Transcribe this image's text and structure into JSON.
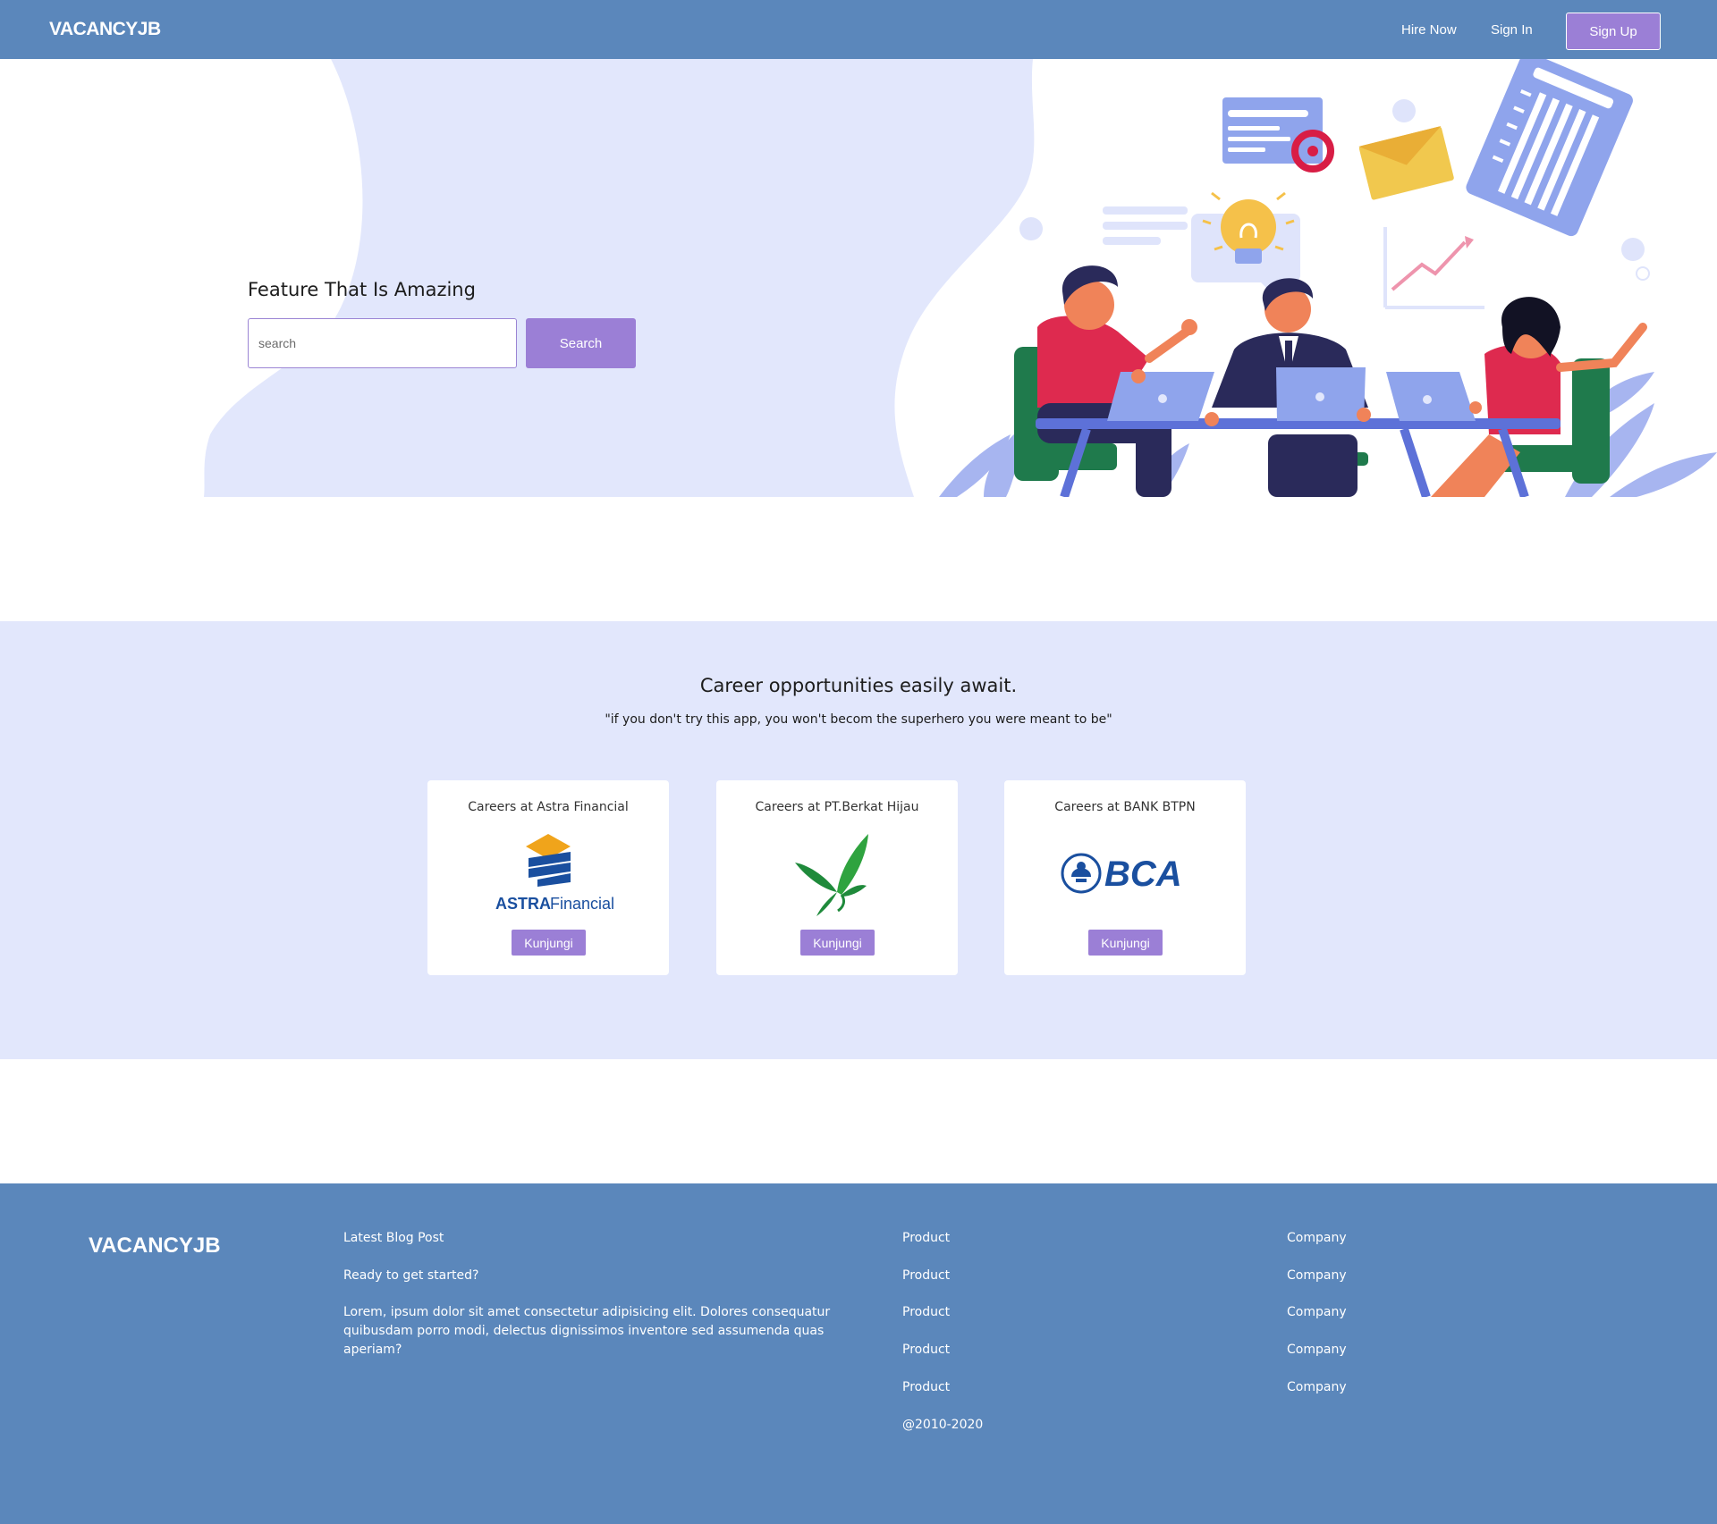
{
  "navbar": {
    "brand": "VACANCYJB",
    "hire_now": "Hire Now",
    "sign_in": "Sign In",
    "sign_up": "Sign Up"
  },
  "hero": {
    "title": "Feature That Is Amazing",
    "search_placeholder": "search",
    "search_button": "Search"
  },
  "careers": {
    "title": "Career opportunities easily await.",
    "subtitle": "\"if you don't try this app, you won't becom the superhero you were meant to be\"",
    "cards": [
      {
        "title": "Careers at Astra Financial",
        "logo_text": "ASTRA",
        "logo_text_2": "Financial",
        "button": "Kunjungi"
      },
      {
        "title": "Careers at PT.Berkat Hijau",
        "button": "Kunjungi"
      },
      {
        "title": "Careers at BANK BTPN",
        "logo_text": "BCA",
        "button": "Kunjungi"
      }
    ]
  },
  "footer": {
    "brand": "VACANCYJB",
    "blog_heading": "Latest Blog Post",
    "blog_subheading": "Ready to get started?",
    "blog_body": "Lorem, ipsum dolor sit amet consectetur adipisicing elit. Dolores consequatur quibusdam porro modi, delectus dignissimos inventore sed assumenda quas aperiam?",
    "product_links": [
      "Product",
      "Product",
      "Product",
      "Product",
      "Product"
    ],
    "company_links": [
      "Company",
      "Company",
      "Company",
      "Company",
      "Company"
    ],
    "copyright": "@2010-2020"
  },
  "colors": {
    "nav_bg": "#5b87bb",
    "accent": "#9b7fd6",
    "hero_blob": "#e2e7fc"
  }
}
